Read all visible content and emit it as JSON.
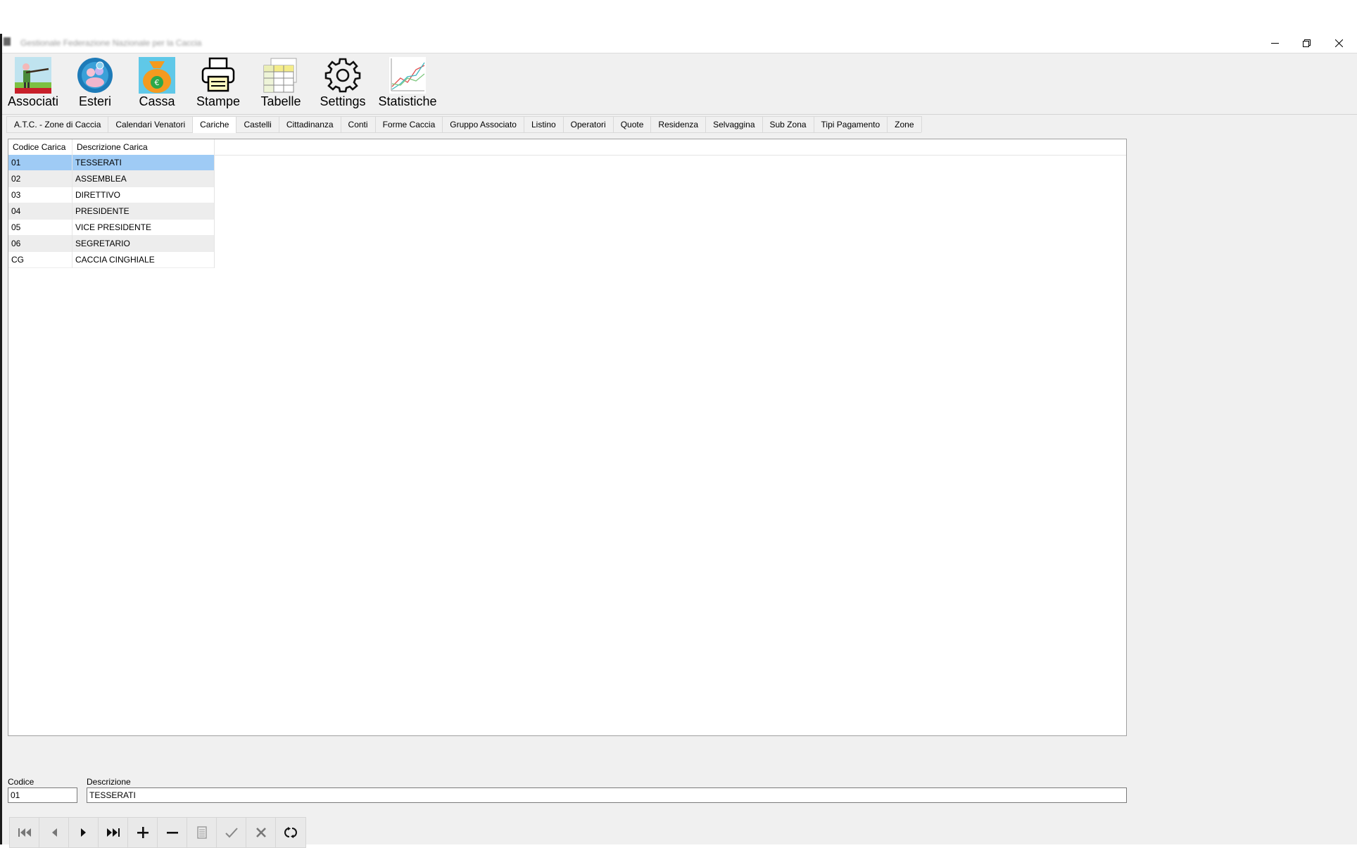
{
  "window": {
    "title": "Gestionale Federazione Nazionale per la Caccia"
  },
  "ribbon": [
    {
      "label": "Associati",
      "icon": "hunter-icon"
    },
    {
      "label": "Esteri",
      "icon": "globe-people-icon"
    },
    {
      "label": "Cassa",
      "icon": "money-bag-icon"
    },
    {
      "label": "Stampe",
      "icon": "printer-icon"
    },
    {
      "label": "Tabelle",
      "icon": "table-icon"
    },
    {
      "label": "Settings",
      "icon": "gear-icon"
    },
    {
      "label": "Statistiche",
      "icon": "line-chart-icon"
    }
  ],
  "tabs": [
    "A.T.C. - Zone di Caccia",
    "Calendari Venatori",
    "Cariche",
    "Castelli",
    "Cittadinanza",
    "Conti",
    "Forme Caccia",
    "Gruppo Associato",
    "Listino",
    "Operatori",
    "Quote",
    "Residenza",
    "Selvaggina",
    "Sub Zona",
    "Tipi Pagamento",
    "Zone"
  ],
  "active_tab": "Cariche",
  "grid": {
    "columns": [
      "Codice Carica",
      "Descrizione Carica"
    ],
    "rows": [
      [
        "01",
        "TESSERATI"
      ],
      [
        "02",
        "ASSEMBLEA"
      ],
      [
        "03",
        "DIRETTIVO"
      ],
      [
        "04",
        "PRESIDENTE"
      ],
      [
        "05",
        "VICE PRESIDENTE"
      ],
      [
        "06",
        "SEGRETARIO"
      ],
      [
        "CG",
        "CACCIA CINGHIALE"
      ]
    ],
    "selected_row": "01"
  },
  "form": {
    "codice_label": "Codice",
    "codice_value": "01",
    "descrizione_label": "Descrizione",
    "descrizione_value": "TESSERATI"
  },
  "navigator": [
    "first-record-icon",
    "previous-record-icon",
    "next-record-icon",
    "last-record-icon",
    "add-record-icon",
    "delete-record-icon",
    "edit-record-icon",
    "confirm-icon",
    "cancel-icon",
    "refresh-icon"
  ],
  "colors": {
    "selected_row": "#9fcbf5",
    "window_bg": "#f0f0f0"
  }
}
